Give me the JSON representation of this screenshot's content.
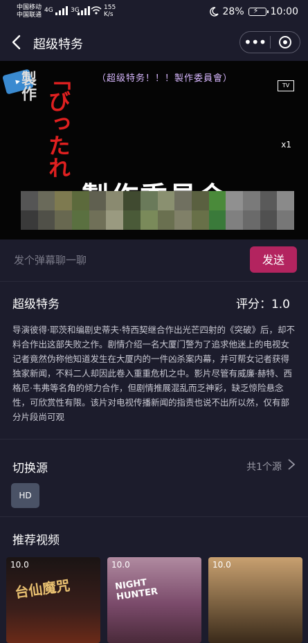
{
  "status": {
    "carrier1": "中国移动",
    "carrier2": "中国联通",
    "network1": "4G",
    "network2": "3G",
    "speed_value": "155",
    "speed_unit": "K/s",
    "battery": "28%",
    "time": "10:00"
  },
  "header": {
    "title": "超级特务"
  },
  "video": {
    "top_caption": "（超级特务！！！製作委員會）",
    "side_text": "製作",
    "red_text": "「びったれ",
    "big_text": "製作委員会",
    "tv_badge": "TV",
    "rate": "x1",
    "mosaic_colors": [
      "#555",
      "#6a6a5a",
      "#7e7a50",
      "#5c6a3c",
      "#606050",
      "#8a8a70",
      "#404a30",
      "#6a7a5a",
      "#8a9070",
      "#707060",
      "#5a6040",
      "#4a8a3a",
      "#909090",
      "#7a7a7a",
      "#5a5a5a",
      "#8a8a8a",
      "#3a3a3a",
      "#505048",
      "#686850",
      "#5a7040",
      "#707058",
      "#9a9a80",
      "#4a5a38",
      "#7a8a5a",
      "#6a7050",
      "#808068",
      "#687048",
      "#3a7a3a",
      "#808080",
      "#6a6a6a",
      "#505050",
      "#777777"
    ]
  },
  "danmu": {
    "placeholder": "发个弹幕聊一聊",
    "send_label": "发送"
  },
  "info": {
    "title": "超级特务",
    "rating": "评分：1.0",
    "description": "导演彼得·耶茨和编剧史蒂夫·特西契继合作出光芒四射的《突破》后，却不料合作出这部失败之作。剧情介绍一名大厦门警为了追求他迷上的电视女记者竟然伪称他知道发生在大厦内的一件凶杀案内幕，并可帮女记者获得独家新闻，不料二人却因此卷入重重危机之中。影片尽管有威廉·赫特、西格尼·韦弗等名角的倾力合作，但剧情推展混乱而乏神彩，缺乏惊险悬念性，可欣赏性有限。该片对电视传播新闻的指责也说不出所以然，仅有部分片段尚可观"
  },
  "source": {
    "title": "切换源",
    "count": "共1个源",
    "chips": [
      "HD"
    ]
  },
  "recommend": {
    "title": "推荐视频",
    "items": [
      {
        "score": "10.0",
        "art_text": "台仙魔咒",
        "bg": "#2a1a18"
      },
      {
        "score": "10.0",
        "art_text": "NIGHT HUNTER",
        "bg": "#8a5a7a"
      },
      {
        "score": "10.0",
        "art_text": "",
        "bg": "#6a5a3a"
      }
    ]
  }
}
